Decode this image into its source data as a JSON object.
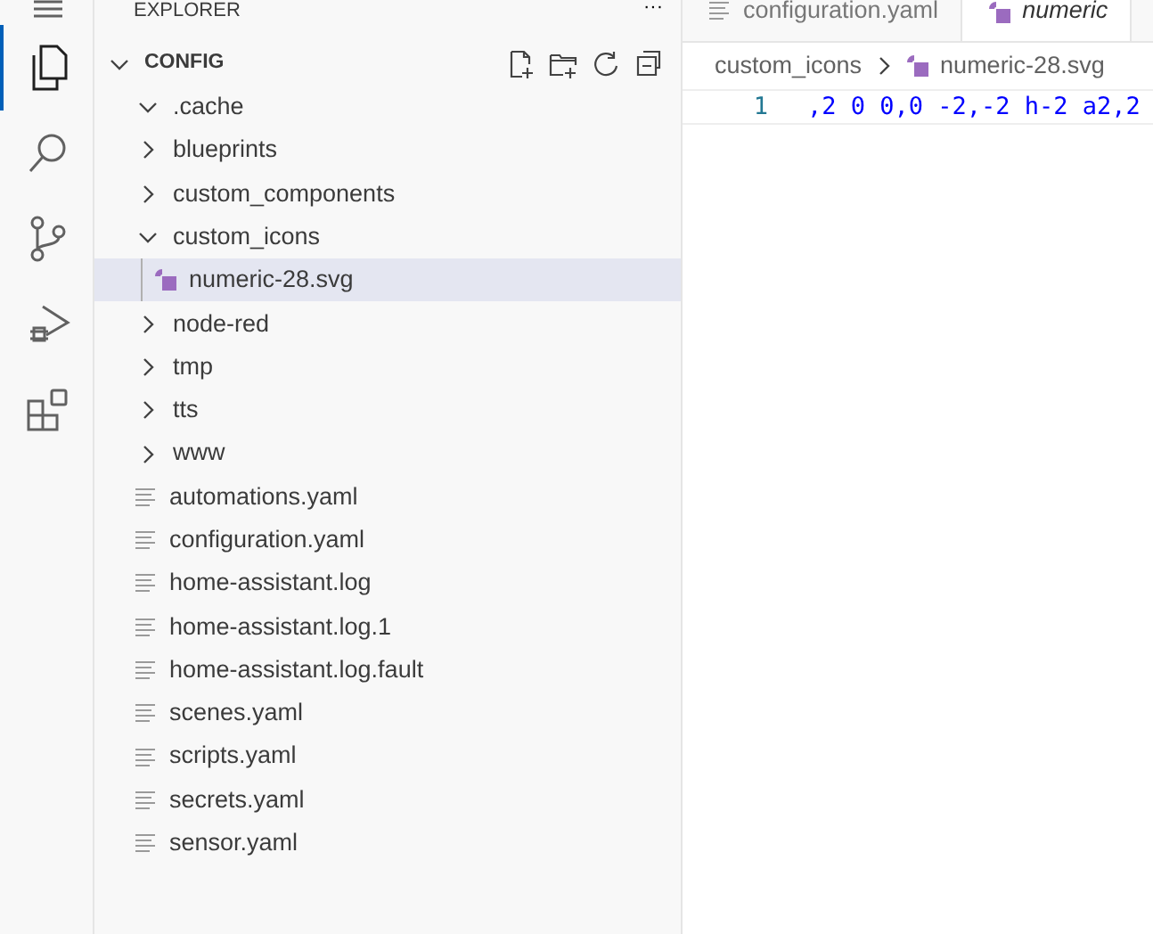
{
  "activity_bar": [
    {
      "kind": "menu",
      "selected": false
    },
    {
      "kind": "explorer",
      "selected": true
    },
    {
      "kind": "search",
      "selected": false
    },
    {
      "kind": "source-control",
      "selected": false
    },
    {
      "kind": "run-debug",
      "selected": false
    },
    {
      "kind": "extensions",
      "selected": false
    }
  ],
  "sidebar": {
    "title": "EXPLORER",
    "more": "···",
    "section": {
      "label": "CONFIG",
      "expanded": true,
      "tree": [
        {
          "kind": "folder",
          "label": ".cache",
          "expanded": true,
          "selected": false
        },
        {
          "kind": "folder",
          "label": "blueprints",
          "expanded": false,
          "selected": false
        },
        {
          "kind": "folder",
          "label": "custom_components",
          "expanded": false,
          "selected": false
        },
        {
          "kind": "folder",
          "label": "custom_icons",
          "expanded": true,
          "selected": false,
          "children": [
            {
              "kind": "svg",
              "label": "numeric-28.svg",
              "selected": true
            }
          ]
        },
        {
          "kind": "folder",
          "label": "node-red",
          "expanded": false,
          "selected": false
        },
        {
          "kind": "folder",
          "label": "tmp",
          "expanded": false,
          "selected": false
        },
        {
          "kind": "folder",
          "label": "tts",
          "expanded": false,
          "selected": false
        },
        {
          "kind": "folder",
          "label": "www",
          "expanded": false,
          "selected": false
        },
        {
          "kind": "text",
          "label": "automations.yaml",
          "selected": false
        },
        {
          "kind": "text",
          "label": "configuration.yaml",
          "selected": false
        },
        {
          "kind": "text",
          "label": "home-assistant.log",
          "selected": false
        },
        {
          "kind": "text",
          "label": "home-assistant.log.1",
          "selected": false
        },
        {
          "kind": "text",
          "label": "home-assistant.log.fault",
          "selected": false
        },
        {
          "kind": "text",
          "label": "scenes.yaml",
          "selected": false
        },
        {
          "kind": "text",
          "label": "scripts.yaml",
          "selected": false
        },
        {
          "kind": "text",
          "label": "secrets.yaml",
          "selected": false
        },
        {
          "kind": "text",
          "label": "sensor.yaml",
          "selected": false
        }
      ]
    }
  },
  "editor": {
    "tabs": [
      {
        "kind": "text",
        "label": "configuration.yaml",
        "selected": false
      },
      {
        "kind": "svg",
        "label": "numeric",
        "selected": true
      }
    ],
    "breadcrumb": [
      {
        "kind": "folder",
        "label": "custom_icons"
      },
      {
        "kind": "svg",
        "label": "numeric-28.svg"
      }
    ],
    "lines": [
      {
        "number": "1",
        "code": ",2 0 0,0 -2,-2 h-2 a2,2"
      }
    ]
  }
}
